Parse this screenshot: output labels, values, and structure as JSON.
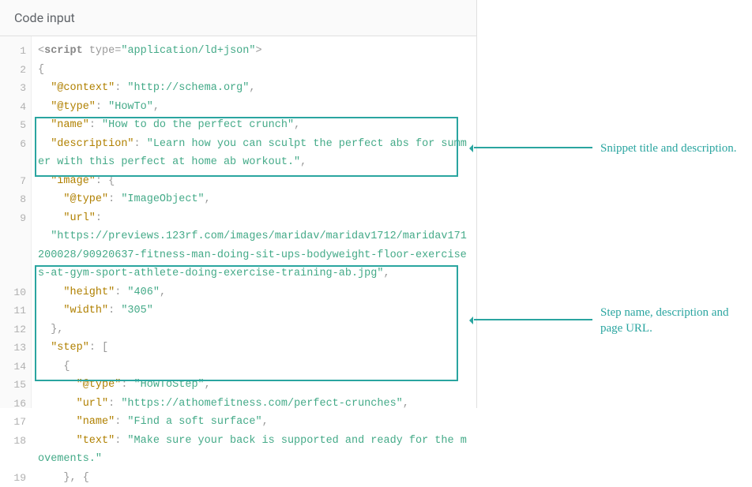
{
  "header": {
    "title": "Code input"
  },
  "gutter": [
    "1",
    "2",
    "3",
    "4",
    "5",
    "6",
    "",
    "7",
    "8",
    "9",
    "",
    "",
    "",
    "10",
    "11",
    "12",
    "13",
    "14",
    "15",
    "16",
    "17",
    "18",
    "",
    "19"
  ],
  "code": {
    "script_open_tag": "script",
    "script_type_attr": "type",
    "script_type_val": "\"application/ld+json\"",
    "l2": "{",
    "l3_key": "\"@context\"",
    "l3_val": "\"http://schema.org\"",
    "l4_key": "\"@type\"",
    "l4_val": "\"HowTo\"",
    "l5_key": "\"name\"",
    "l5_val": "\"How to do the perfect crunch\"",
    "l6_key": "\"description\"",
    "l6_val": "\"Learn how you can sculpt the perfect abs for summer with this perfect at home ab workout.\"",
    "l7_key": "\"image\"",
    "l7_val": "{",
    "l8_key": "\"@type\"",
    "l8_val": "\"ImageObject\"",
    "l9_key": "\"url\"",
    "l9_val": "\"https://previews.123rf.com/images/maridav/maridav1712/maridav171200028/90920637-fitness-man-doing-sit-ups-bodyweight-floor-exercises-at-gym-sport-athlete-doing-exercise-training-ab.jpg\"",
    "l10_key": "\"height\"",
    "l10_val": "\"406\"",
    "l11_key": "\"width\"",
    "l11_val": "\"305\"",
    "l12": "},",
    "l13_key": "\"step\"",
    "l13_val": "[",
    "l14": "{",
    "l15_key": "\"@type\"",
    "l15_val": "\"HowToStep\"",
    "l16_key": "\"url\"",
    "l16_val": "\"https://athomefitness.com/perfect-crunches\"",
    "l17_key": "\"name\"",
    "l17_val": "\"Find a soft surface\"",
    "l18_key": "\"text\"",
    "l18_val": "\"Make sure your back is supported and ready for the movements.\"",
    "l19": "}, {"
  },
  "annotations": {
    "a1": "Snippet title and description.",
    "a2": "Step name, description and page URL."
  }
}
